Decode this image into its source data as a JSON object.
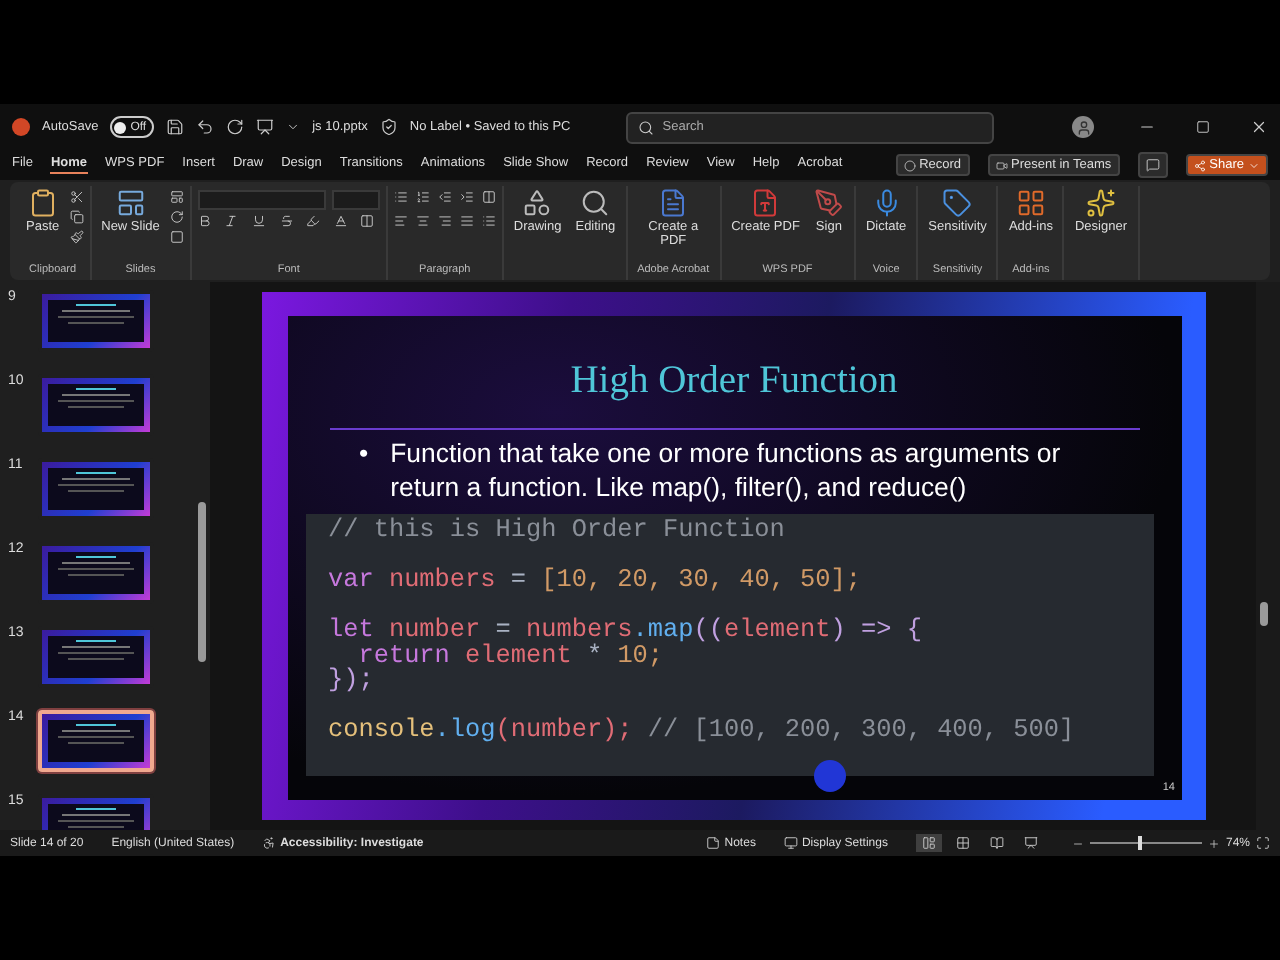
{
  "title_bar": {
    "autosave_label": "AutoSave",
    "autosave": {
      "on": false,
      "label": "Off"
    },
    "file_name": "js 10.pptx",
    "file_status": "No Label • Saved to this PC",
    "search": {
      "placeholder": "Search"
    }
  },
  "menu_tabs": [
    {
      "label": "File",
      "selected": false
    },
    {
      "label": "Home",
      "selected": true
    },
    {
      "label": "WPS PDF",
      "selected": false
    },
    {
      "label": "Insert",
      "selected": false
    },
    {
      "label": "Draw",
      "selected": false
    },
    {
      "label": "Design",
      "selected": false
    },
    {
      "label": "Transitions",
      "selected": false
    },
    {
      "label": "Animations",
      "selected": false
    },
    {
      "label": "Slide Show",
      "selected": false
    },
    {
      "label": "Record",
      "selected": false
    },
    {
      "label": "Review",
      "selected": false
    },
    {
      "label": "View",
      "selected": false
    },
    {
      "label": "Help",
      "selected": false
    },
    {
      "label": "Acrobat",
      "selected": false
    }
  ],
  "menu_actions": [
    {
      "label": "Record",
      "kind": "record"
    },
    {
      "label": "Present in Teams",
      "kind": "teams"
    },
    {
      "label": "Share",
      "kind": "share"
    }
  ],
  "ribbon_groups": [
    {
      "label": "Clipboard",
      "kind": "clipboard",
      "buttons": [
        {
          "label": "Paste",
          "kind": "paste"
        }
      ]
    },
    {
      "label": "Slides",
      "kind": "slides",
      "buttons": [
        {
          "label": "New Slide",
          "kind": "new-slide"
        }
      ]
    },
    {
      "label": "Font",
      "kind": "font"
    },
    {
      "label": "Paragraph",
      "kind": "paragraph"
    },
    {
      "kind": "buttons",
      "buttons": [
        {
          "label": "Drawing",
          "kind": "drawing"
        },
        {
          "label": "Editing",
          "kind": "editing"
        }
      ]
    },
    {
      "label": "Adobe Acrobat",
      "kind": "buttons",
      "buttons": [
        {
          "label": "Create a PDF",
          "kind": "acrobat"
        }
      ]
    },
    {
      "label": "WPS PDF",
      "kind": "buttons",
      "buttons": [
        {
          "label": "Create PDF",
          "kind": "pdf"
        },
        {
          "label": "Sign",
          "kind": "sign"
        }
      ]
    },
    {
      "label": "Voice",
      "kind": "buttons",
      "buttons": [
        {
          "label": "Dictate",
          "kind": "dictate"
        }
      ]
    },
    {
      "label": "Sensitivity",
      "kind": "buttons",
      "buttons": [
        {
          "label": "Sensitivity",
          "kind": "sensitivity"
        }
      ]
    },
    {
      "label": "Add-ins",
      "kind": "buttons",
      "buttons": [
        {
          "label": "Add-ins",
          "kind": "addins"
        }
      ]
    },
    {
      "kind": "buttons",
      "buttons": [
        {
          "label": "Designer",
          "kind": "designer"
        }
      ]
    }
  ],
  "thumbnails": [
    {
      "number": "9",
      "selected": false
    },
    {
      "number": "10",
      "selected": false
    },
    {
      "number": "11",
      "selected": false
    },
    {
      "number": "12",
      "selected": false
    },
    {
      "number": "13",
      "selected": false
    },
    {
      "number": "14",
      "selected": true
    },
    {
      "number": "15",
      "selected": false
    }
  ],
  "slide": {
    "title": "High Order Function",
    "bullet_marker": "•",
    "bullet": "Function that take one or more functions as arguments or return a function. Like map(), filter(), and reduce()",
    "page_number": "14",
    "code_paragraphs": [
      [
        [
          {
            "text": "// this is High Order Function",
            "kind": "comment"
          }
        ]
      ],
      [
        [
          {
            "text": "var",
            "kind": "keyword"
          },
          {
            "text": " numbers",
            "kind": "variable"
          },
          {
            "text": " = ",
            "kind": "operator"
          },
          {
            "text": "[10, 20, 30, 40, 50];",
            "kind": "number"
          }
        ]
      ],
      [
        [
          {
            "text": "let",
            "kind": "keyword"
          },
          {
            "text": " number",
            "kind": "variable"
          },
          {
            "text": " = ",
            "kind": "operator"
          },
          {
            "text": "numbers",
            "kind": "variable"
          },
          {
            "text": ".map",
            "kind": "function"
          },
          {
            "text": "((",
            "kind": "punctuation"
          },
          {
            "text": "element",
            "kind": "variable"
          },
          {
            "text": ") => {",
            "kind": "punctuation"
          }
        ],
        [
          {
            "text": "  return",
            "kind": "keyword"
          },
          {
            "text": " element",
            "kind": "variable"
          },
          {
            "text": " * ",
            "kind": "operator"
          },
          {
            "text": "10;",
            "kind": "number"
          }
        ],
        [
          {
            "text": "});",
            "kind": "punctuation"
          }
        ]
      ],
      [
        [
          {
            "text": "console",
            "kind": "object"
          },
          {
            "text": ".log",
            "kind": "function"
          },
          {
            "text": "(number);",
            "kind": "variable"
          },
          {
            "text": " // [100, 200, 300, 400, 500]",
            "kind": "comment"
          }
        ]
      ]
    ]
  },
  "status_bar": {
    "slide_info": "Slide 14 of 20",
    "language": "English (United States)",
    "accessibility": "Accessibility: Investigate",
    "notes": "Notes",
    "display_settings": "Display Settings",
    "views": [
      {
        "selected": true
      },
      {
        "selected": false
      },
      {
        "selected": false
      },
      {
        "selected": false
      }
    ],
    "zoom": {
      "level": 0.42,
      "label": "74%"
    }
  }
}
